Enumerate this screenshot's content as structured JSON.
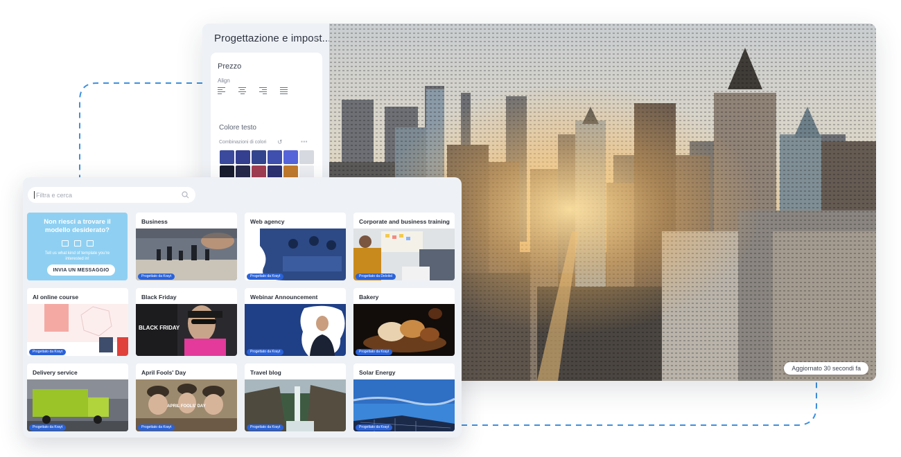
{
  "editor": {
    "panel_title": "Progettazione e impost...",
    "close_glyph": "×",
    "section_label": "Prezzo",
    "align_label": "Align",
    "align_options": [
      "align-left",
      "align-center",
      "align-right",
      "align-justify"
    ],
    "text_color_label": "Colore testo",
    "combos_label": "Combinazioni di colori",
    "reset_glyph": "↺",
    "swatches": [
      "#3b4a9c",
      "#353f8f",
      "#33448e",
      "#3e4fae",
      "#5664d9",
      "#d6d9e0",
      "#181c2e",
      "#26294a",
      "#a13d52",
      "#2c3170",
      "#c17a2c",
      "#eceef2"
    ],
    "grays": [
      "#ffffff",
      "#e3e4e8",
      "#b9bbc1",
      "#8c8f96",
      "#66686f",
      "#45474c",
      "#2a2b2f",
      "#0e0e10"
    ],
    "hex_value": "#ffffff",
    "check_glyph": "✓",
    "updated_label": "Aggiornato 30 secondi fa"
  },
  "gallery": {
    "search_placeholder": "Filtra e cerca",
    "promo": {
      "title": "Non riesci a trovare il modello desiderato?",
      "text": "Tell us what kind of template you're interested in!",
      "button": "INVIA UN MESSAGGIO"
    },
    "templates": [
      {
        "title": "Business",
        "badge": "Progettato da Krayt",
        "theme": "chess"
      },
      {
        "title": "Web agency",
        "badge": "Progettato da Krayt",
        "theme": "team"
      },
      {
        "title": "Corporate and business training",
        "badge": "Progettato da Deloitel",
        "theme": "office"
      },
      {
        "title": "AI online course",
        "badge": "Progettato da Krayt",
        "theme": "ai"
      },
      {
        "title": "Black Friday",
        "badge": "",
        "theme": "blackfriday",
        "thumb_text": "BLACK FRIDAY"
      },
      {
        "title": "Webinar Announcement",
        "badge": "Progettato da Krayt",
        "theme": "webinar"
      },
      {
        "title": "Bakery",
        "badge": "Progettato da Krayt",
        "theme": "bakery"
      },
      {
        "title": "Delivery service",
        "badge": "Progettato da Krayt",
        "theme": "delivery"
      },
      {
        "title": "April Fools' Day",
        "badge": "Progettato da Krayt",
        "theme": "fools",
        "thumb_text": "APRIL FOOLS' DAY"
      },
      {
        "title": "Travel blog",
        "badge": "Progettato da Krayt",
        "theme": "travel"
      },
      {
        "title": "Solar Energy",
        "badge": "Progettato da Krayt",
        "theme": "solar"
      }
    ]
  },
  "colors": {
    "accent": "#2a62d8",
    "promo_bg": "#8fd0f2",
    "window_bg": "#eef1f5",
    "connector": "#3b8fe0"
  }
}
